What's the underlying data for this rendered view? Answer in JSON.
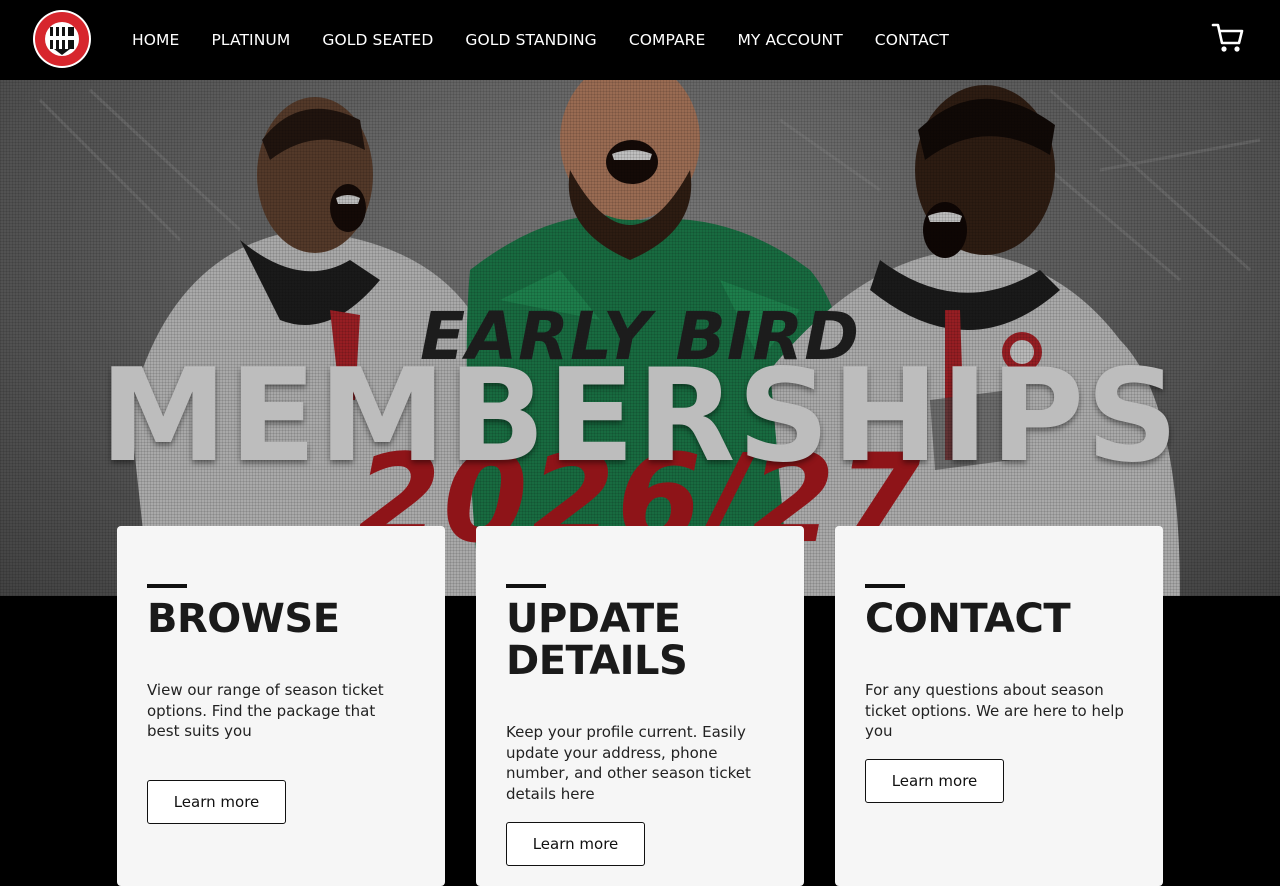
{
  "nav": {
    "logo_alt": "club crest",
    "items": [
      {
        "label": "HOME"
      },
      {
        "label": "PLATINUM"
      },
      {
        "label": "GOLD SEATED"
      },
      {
        "label": "GOLD STANDING"
      },
      {
        "label": "COMPARE"
      },
      {
        "label": "MY ACCOUNT"
      },
      {
        "label": "CONTACT"
      }
    ],
    "cart_icon": "cart-icon"
  },
  "hero": {
    "eyebrow": "EARLY BIRD",
    "title": "MEMBERSHIPS",
    "season": "2026/27"
  },
  "cards": [
    {
      "title": "BROWSE",
      "text": "View our range of season ticket options. Find the package that best suits you",
      "button": "Learn more"
    },
    {
      "title": "UPDATE DETAILS",
      "text": "Keep your profile current. Easily update your address, phone number, and other season ticket details here",
      "button": "Learn more"
    },
    {
      "title": "CONTACT",
      "text": "For any questions about season ticket options. We are here to help you",
      "button": "Learn more"
    }
  ],
  "colors": {
    "nav_bg": "#000000",
    "card_bg": "#f6f6f6",
    "accent_red": "#d7262d"
  }
}
